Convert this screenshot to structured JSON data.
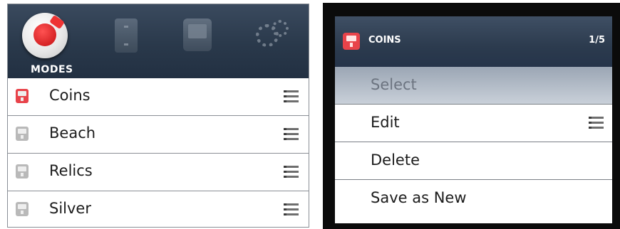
{
  "modes_panel": {
    "tab_label": "MODES",
    "modes": [
      {
        "label": "Coins",
        "icon": "mode-card-icon",
        "active": true
      },
      {
        "label": "Beach",
        "icon": "mode-card-icon",
        "active": false
      },
      {
        "label": "Relics",
        "icon": "mode-card-icon",
        "active": false
      },
      {
        "label": "Silver",
        "icon": "mode-card-icon",
        "active": false
      }
    ]
  },
  "context_menu": {
    "title": "COINS",
    "page": "1/5",
    "items": [
      {
        "label": "Select",
        "selected": true
      },
      {
        "label": "Edit",
        "has_icon": true
      },
      {
        "label": "Delete"
      },
      {
        "label": "Save as New"
      }
    ]
  },
  "colors": {
    "header": "#2c3b4e",
    "accent_red": "#e8434a",
    "selection": "#9ba6b4"
  }
}
